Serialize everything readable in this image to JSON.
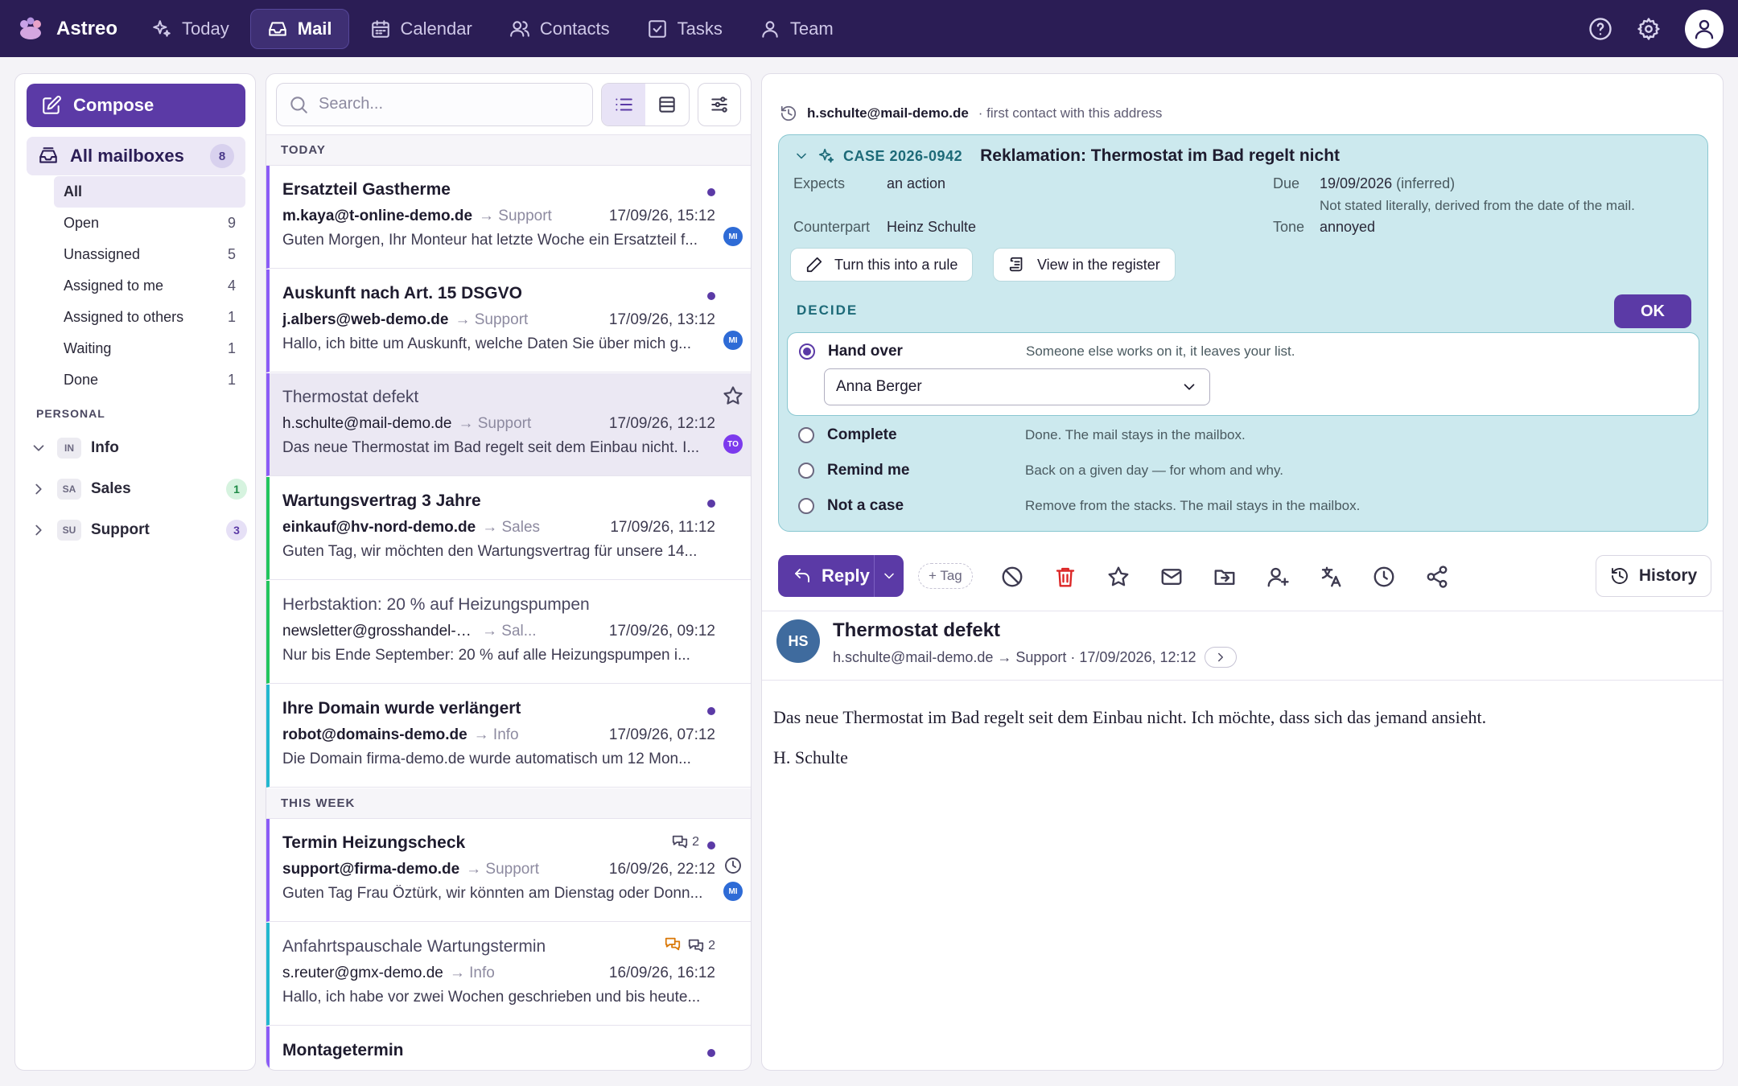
{
  "app": {
    "name": "Astreo"
  },
  "nav": {
    "items": [
      {
        "label": "Today",
        "icon": "sparkle-icon"
      },
      {
        "label": "Mail",
        "icon": "inbox-icon",
        "active": true
      },
      {
        "label": "Calendar",
        "icon": "calendar-icon"
      },
      {
        "label": "Contacts",
        "icon": "contacts-icon"
      },
      {
        "label": "Tasks",
        "icon": "checkbox-icon"
      },
      {
        "label": "Team",
        "icon": "user-icon"
      }
    ]
  },
  "sidebar": {
    "compose_label": "Compose",
    "all_mailboxes": {
      "label": "All mailboxes",
      "count": "8"
    },
    "filters": [
      {
        "label": "All",
        "count": ""
      },
      {
        "label": "Open",
        "count": "9"
      },
      {
        "label": "Unassigned",
        "count": "5"
      },
      {
        "label": "Assigned to me",
        "count": "4"
      },
      {
        "label": "Assigned to others",
        "count": "1"
      },
      {
        "label": "Waiting",
        "count": "1"
      },
      {
        "label": "Done",
        "count": "1"
      }
    ],
    "personal_label": "PERSONAL",
    "mailboxes": [
      {
        "abbr": "IN",
        "label": "Info",
        "count": "",
        "expanded": true
      },
      {
        "abbr": "SA",
        "label": "Sales",
        "count": "1",
        "badge_color": "#d6f3df",
        "badge_text": "#1e8a46"
      },
      {
        "abbr": "SU",
        "label": "Support",
        "count": "3",
        "badge_color": "#e6e0f6",
        "badge_text": "#5b3aa6"
      }
    ]
  },
  "list": {
    "search_placeholder": "Search...",
    "groups": {
      "today": "TODAY",
      "week": "THIS WEEK"
    },
    "messages": [
      {
        "subject": "Ersatzteil Gastherme",
        "from": "m.kaya@t-online-demo.de",
        "mailbox": "→ Support",
        "date": "17/09/26, 15:12",
        "preview": "Guten Morgen, Ihr Monteur hat letzte Woche ein Ersatzteil f...",
        "assignee": "MI",
        "bar": "#8b5cf6"
      },
      {
        "subject": "Auskunft nach Art. 15 DSGVO",
        "from": "j.albers@web-demo.de",
        "mailbox": "→ Support",
        "date": "17/09/26, 13:12",
        "preview": "Hallo, ich bitte um Auskunft, welche Daten Sie über mich g...",
        "assignee": "MI",
        "bar": "#8b5cf6"
      },
      {
        "subject": "Thermostat defekt",
        "from": "h.schulte@mail-demo.de",
        "mailbox": "→ Support",
        "date": "17/09/26, 12:12",
        "preview": "Das neue Thermostat im Bad regelt seit dem Einbau nicht. I...",
        "assignee": "TO",
        "bar": "#8b5cf6"
      },
      {
        "subject": "Wartungsvertrag 3 Jahre",
        "from": "einkauf@hv-nord-demo.de",
        "mailbox": "→ Sales",
        "date": "17/09/26, 11:12",
        "preview": "Guten Tag, wir möchten den Wartungsvertrag für unsere 14...",
        "bar": "#22c55e"
      },
      {
        "subject": "Herbstaktion: 20 % auf Heizungspumpen",
        "from": "newsletter@grosshandel-demo...",
        "mailbox": "→ Sal...",
        "date": "17/09/26, 09:12",
        "preview": "Nur bis Ende September: 20 % auf alle Heizungspumpen i...",
        "bar": "#22c55e"
      },
      {
        "subject": "Ihre Domain wurde verlängert",
        "from": "robot@domains-demo.de",
        "mailbox": "→ Info",
        "date": "17/09/26, 07:12",
        "preview": "Die Domain firma-demo.de wurde automatisch um 12 Mon...",
        "bar": "#22b8cf"
      },
      {
        "subject": "Termin Heizungscheck",
        "from": "support@firma-demo.de",
        "mailbox": "→ Support",
        "date": "16/09/26, 22:12",
        "preview": "Guten Tag Frau Öztürk, wir könnten am Dienstag oder Donn...",
        "assignee": "MI",
        "thread_count": "2",
        "bar": "#8b5cf6"
      },
      {
        "subject": "Anfahrtspauschale Wartungstermin",
        "from": "s.reuter@gmx-demo.de",
        "mailbox": "→ Info",
        "date": "16/09/26, 16:12",
        "preview": "Hallo, ich habe vor zwei Wochen geschrieben und bis heute...",
        "thread_count": "2",
        "bar": "#22b8cf"
      },
      {
        "subject": "Montagetermin",
        "from": "",
        "mailbox": "",
        "date": "",
        "preview": "",
        "bar": "#8b5cf6"
      }
    ]
  },
  "reader": {
    "contact": {
      "address": "h.schulte@mail-demo.de",
      "note": "· first contact with this address"
    },
    "case": {
      "id": "CASE 2026-0942",
      "title": "Reklamation: Thermostat im Bad regelt nicht",
      "expects_label": "Expects",
      "expects_value": "an action",
      "due_label": "Due",
      "due_value": "19/09/2026",
      "due_inferred": "(inferred)",
      "due_note": "Not stated literally, derived from the date of the mail.",
      "counterpart_label": "Counterpart",
      "counterpart_value": "Heinz Schulte",
      "tone_label": "Tone",
      "tone_value": "annoyed",
      "rule_button": "Turn this into a rule",
      "register_button": "View in the register",
      "decide_label": "DECIDE",
      "ok_label": "OK",
      "options": [
        {
          "label": "Hand over",
          "desc": "Someone else works on it, it leaves your list.",
          "selected": true
        },
        {
          "label": "Complete",
          "desc": "Done. The mail stays in the mailbox."
        },
        {
          "label": "Remind me",
          "desc": "Back on a given day — for whom and why."
        },
        {
          "label": "Not a case",
          "desc": "Remove from the stacks. The mail stays in the mailbox."
        }
      ],
      "handover_to": "Anna Berger"
    },
    "toolbar": {
      "reply_label": "Reply",
      "tag_label": "+ Tag",
      "history_label": "History"
    },
    "message": {
      "initials": "HS",
      "subject": "Thermostat defekt",
      "meta": "h.schulte@mail-demo.de → Support · 17/09/2026, 12:12",
      "body": [
        "Das neue Thermostat im Bad regelt seit dem Einbau nicht. Ich möchte, dass sich das jemand ansieht.",
        "H. Schulte"
      ]
    }
  }
}
